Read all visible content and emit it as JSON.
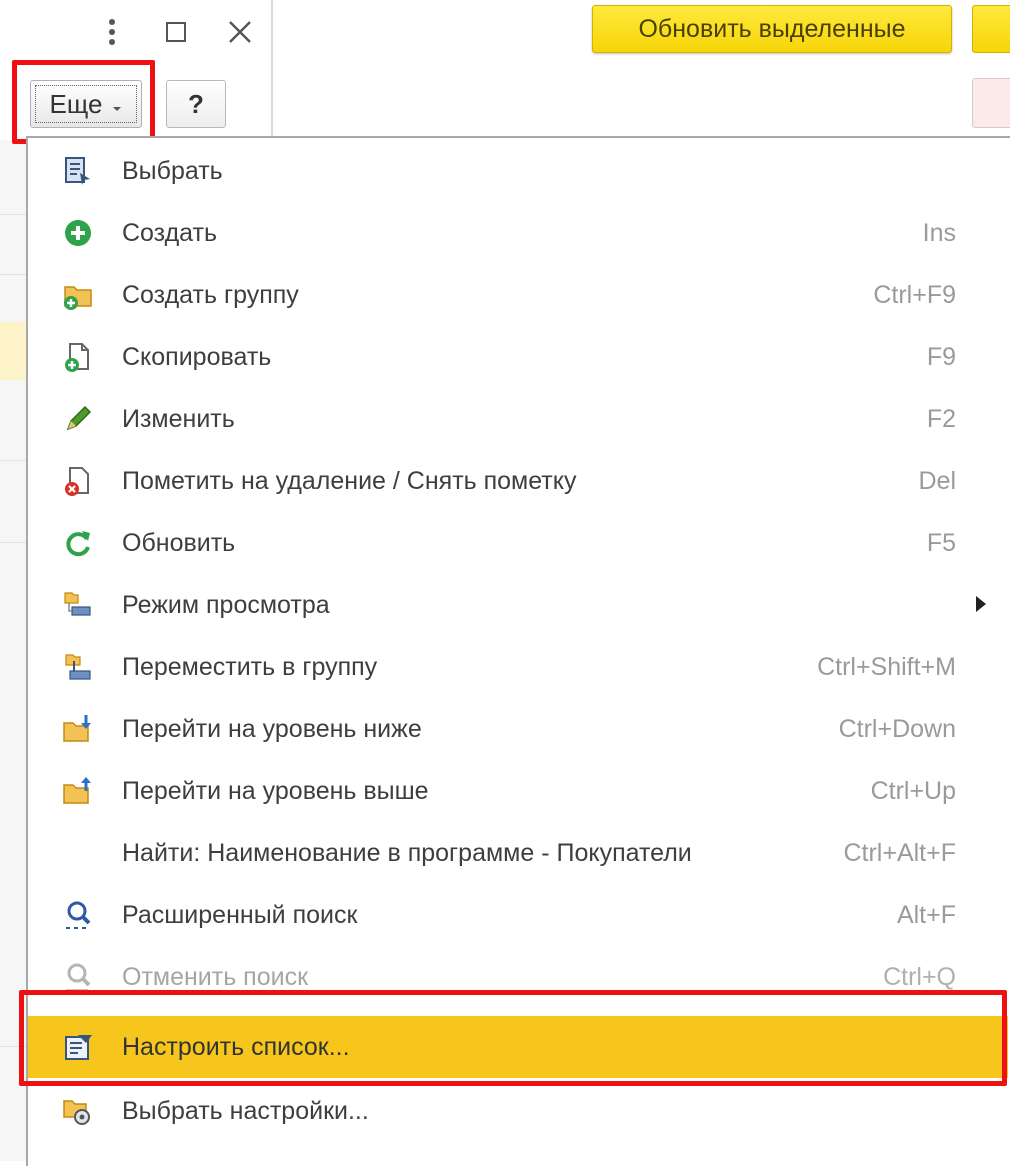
{
  "window": {
    "icons": [
      "more-vertical-icon",
      "maximize-icon",
      "close-icon"
    ]
  },
  "toolbar": {
    "more_label": "Еще",
    "help_label": "?",
    "refresh_selected_label": "Обновить выделенные"
  },
  "menu": {
    "items": [
      {
        "label": "Выбрать",
        "shortcut": "",
        "icon": "select-icon"
      },
      {
        "label": "Создать",
        "shortcut": "Ins",
        "icon": "create-icon"
      },
      {
        "label": "Создать группу",
        "shortcut": "Ctrl+F9",
        "icon": "create-group-icon"
      },
      {
        "label": "Скопировать",
        "shortcut": "F9",
        "icon": "copy-icon"
      },
      {
        "label": "Изменить",
        "shortcut": "F2",
        "icon": "edit-icon"
      },
      {
        "label": "Пометить на удаление / Снять пометку",
        "shortcut": "Del",
        "icon": "mark-delete-icon"
      },
      {
        "label": "Обновить",
        "shortcut": "F5",
        "icon": "refresh-icon"
      },
      {
        "label": "Режим просмотра",
        "shortcut": "",
        "icon": "view-mode-icon",
        "submenu": true
      },
      {
        "label": "Переместить в группу",
        "shortcut": "Ctrl+Shift+M",
        "icon": "move-to-group-icon"
      },
      {
        "label": "Перейти на уровень ниже",
        "shortcut": "Ctrl+Down",
        "icon": "level-down-icon"
      },
      {
        "label": "Перейти на уровень выше",
        "shortcut": "Ctrl+Up",
        "icon": "level-up-icon"
      },
      {
        "label": "Найти: Наименование в программе - Покупатели",
        "shortcut": "Ctrl+Alt+F",
        "icon": ""
      },
      {
        "label": "Расширенный поиск",
        "shortcut": "Alt+F",
        "icon": "advanced-search-icon"
      },
      {
        "label": "Отменить поиск",
        "shortcut": "Ctrl+Q",
        "icon": "cancel-search-icon",
        "disabled": true
      },
      {
        "label": "Настроить список...",
        "shortcut": "",
        "icon": "configure-list-icon",
        "active": true
      },
      {
        "label": "Выбрать настройки...",
        "shortcut": "",
        "icon": "choose-settings-icon"
      }
    ]
  },
  "colors": {
    "highlight_border": "#ee1111",
    "active_item": "#f7c61c",
    "yellow_button": "#f6d508"
  }
}
